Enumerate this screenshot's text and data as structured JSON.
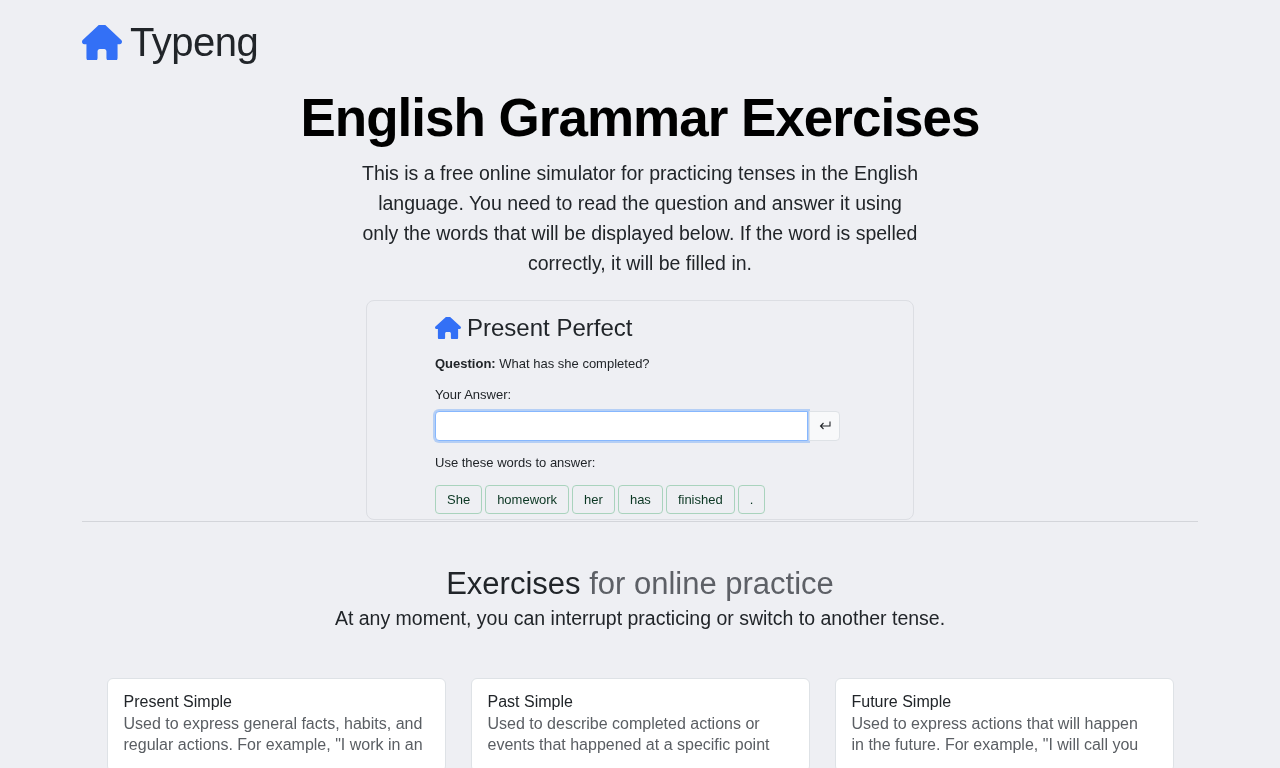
{
  "header": {
    "logo": "Typeng"
  },
  "hero": {
    "title": "English Grammar Exercises",
    "description": "This is a free online simulator for practicing tenses in the English language. You need to read the question and answer it using only the words that will be displayed below. If the word is spelled correctly, it will be filled in."
  },
  "demo": {
    "title": "Present Perfect",
    "question": "**Question:** What has she completed?",
    "answer_label": "Your Answer:",
    "answer_field": {
      "focused": true
    },
    "words_label": "Use these words to answer:",
    "words": [
      "She",
      "homework",
      "her",
      "has",
      "finished",
      "."
    ]
  },
  "exercises": {
    "heading": "Exercises",
    "heading_accent": "for online practice",
    "subtitle": "At any moment, you can interrupt practicing or switch to another tense.",
    "cards": [
      {
        "title": "Present Simple",
        "description": "Used to express general facts, habits, and regular actions. For example, \"I work in an"
      },
      {
        "title": "Past Simple",
        "description": "Used to describe completed actions or events that happened at a specific point"
      },
      {
        "title": "Future Simple",
        "description": "Used to express actions that will happen in the future. For example, \"I will call you"
      }
    ]
  }
}
